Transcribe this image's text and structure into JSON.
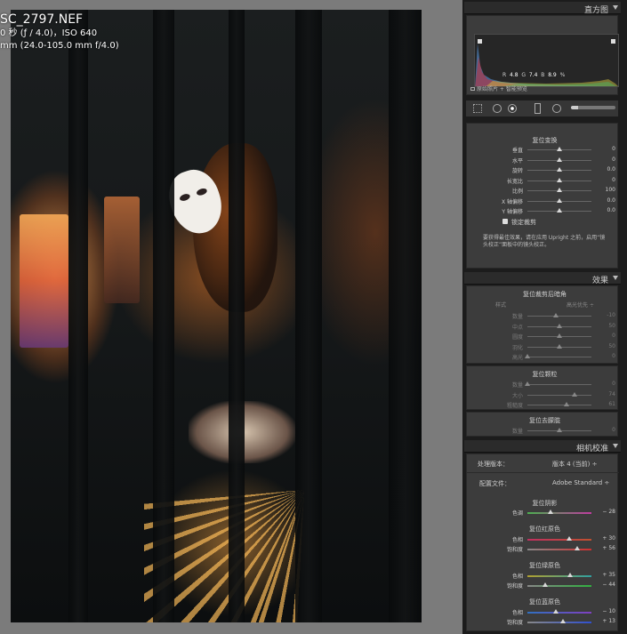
{
  "photo": {
    "filename": "SC_2797.NEF",
    "exposure": "0 秒 (ƒ / 4.0)，ISO 640",
    "lens": "mm (24.0-105.0 mm f/4.0)"
  },
  "histogram": {
    "title": "直方图",
    "readout": [
      "R",
      "4.8",
      "G",
      "7.4",
      "B",
      "8.9",
      "%"
    ],
    "caption": "原始照片 + 智能预览"
  },
  "transform": {
    "title": "复位变换",
    "rows": [
      {
        "label": "垂直",
        "value": "0",
        "pos": 0.5
      },
      {
        "label": "水平",
        "value": "0",
        "pos": 0.5
      },
      {
        "label": "旋转",
        "value": "0.0",
        "pos": 0.5
      },
      {
        "label": "长宽比",
        "value": "0",
        "pos": 0.5
      },
      {
        "label": "比例",
        "value": "100",
        "pos": 0.5
      },
      {
        "label": "X 轴偏移",
        "value": "0.0",
        "pos": 0.5
      },
      {
        "label": "Y 轴偏移",
        "value": "0.0",
        "pos": 0.5
      }
    ],
    "lock_label": "锁定裁剪",
    "note": "要获得最佳效果，请在应用 Upright 之前，启用“镜头校正”面板中的镜头校正。"
  },
  "effects": {
    "title": "效果",
    "vignette_title": "复位裁剪后暗角",
    "style_label": "样式",
    "style_value": "高光优先 ÷",
    "vignette_rows": [
      {
        "label": "数量",
        "value": "-10",
        "pos": 0.45
      },
      {
        "label": "中点",
        "value": "50",
        "pos": 0.5
      },
      {
        "label": "圆度",
        "value": "0",
        "pos": 0.5
      },
      {
        "label": "羽化",
        "value": "50",
        "pos": 0.5
      },
      {
        "label": "高光",
        "value": "0",
        "pos": 0.0
      }
    ],
    "grain_title": "复位颗粒",
    "grain_rows": [
      {
        "label": "数量",
        "value": "0",
        "pos": 0.0
      },
      {
        "label": "大小",
        "value": "74",
        "pos": 0.74
      },
      {
        "label": "粗糙度",
        "value": "61",
        "pos": 0.61
      }
    ],
    "dehaze_title": "复位去朦胧",
    "dehaze_rows": [
      {
        "label": "数量",
        "value": "0",
        "pos": 0.5
      }
    ]
  },
  "calibration": {
    "title": "相机校准",
    "process_label": "处理版本：",
    "process_value": "版本 4 (当前) ÷",
    "profile_label": "配置文件：",
    "profile_value": "Adobe Standard ÷",
    "shadows_title": "复位阴影",
    "shadows_rows": [
      {
        "label": "色调",
        "value": "− 28",
        "pos": 0.36,
        "track": "tint"
      }
    ],
    "red_title": "复位红原色",
    "red_rows": [
      {
        "label": "色相",
        "value": "+ 30",
        "pos": 0.65,
        "track": "red-hue"
      },
      {
        "label": "饱和度",
        "value": "+ 56",
        "pos": 0.78,
        "track": "red-sat"
      }
    ],
    "green_title": "复位绿原色",
    "green_rows": [
      {
        "label": "色相",
        "value": "+ 35",
        "pos": 0.67,
        "track": "green-hue"
      },
      {
        "label": "饱和度",
        "value": "− 44",
        "pos": 0.28,
        "track": "green-sat"
      }
    ],
    "blue_title": "复位蓝原色",
    "blue_rows": [
      {
        "label": "色相",
        "value": "− 10",
        "pos": 0.45,
        "track": "blue-hue"
      },
      {
        "label": "饱和度",
        "value": "+ 13",
        "pos": 0.56,
        "track": "blue-sat"
      }
    ]
  },
  "colors": {
    "panel": "#1c1c1c",
    "section": "#3c3c3c",
    "text": "#cfcfcf",
    "background": "#7b7b7b"
  }
}
